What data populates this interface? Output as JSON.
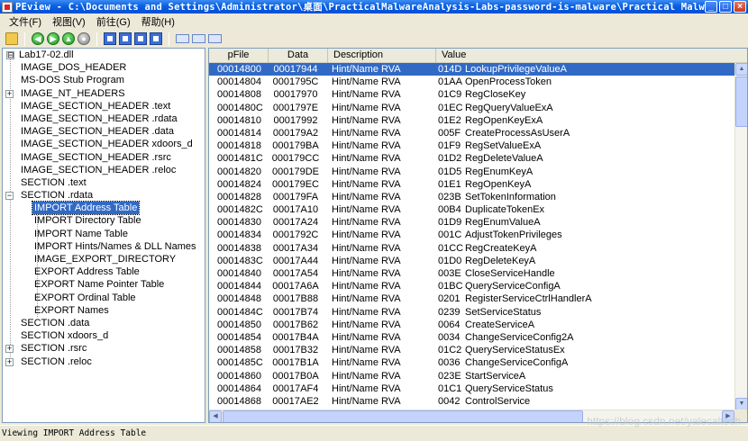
{
  "window": {
    "title": "PEview - C:\\Documents and Settings\\Administrator\\桌面\\PracticalMalwareAnalysis-Labs-password-is-malware\\Practical Malw...",
    "minimize_label": "_",
    "maximize_label": "□",
    "close_label": "×"
  },
  "menu": [
    {
      "label": "文件(F)"
    },
    {
      "label": "视图(V)"
    },
    {
      "label": "前往(G)"
    },
    {
      "label": "帮助(H)"
    }
  ],
  "toolbar": {
    "icons": [
      "open-folder-icon",
      "back-icon",
      "forward-icon",
      "up-icon",
      "refresh-icon",
      "page-prev-icon",
      "page-next-icon",
      "page-first-icon",
      "page-last-icon",
      "view-byte-icon",
      "view-word-icon",
      "view-dword-icon"
    ],
    "nav_glyphs": {
      "back": "◀",
      "forward": "▶",
      "up": "▲",
      "refresh": "●"
    }
  },
  "tree": {
    "items": [
      {
        "label": "Lab17-02.dll",
        "level": 0,
        "expander": "⊟"
      },
      {
        "label": "IMAGE_DOS_HEADER",
        "level": 1,
        "expander": ""
      },
      {
        "label": "MS-DOS Stub Program",
        "level": 1,
        "expander": ""
      },
      {
        "label": "IMAGE_NT_HEADERS",
        "level": 1,
        "expander": "+"
      },
      {
        "label": "IMAGE_SECTION_HEADER .text",
        "level": 1,
        "expander": ""
      },
      {
        "label": "IMAGE_SECTION_HEADER .rdata",
        "level": 1,
        "expander": ""
      },
      {
        "label": "IMAGE_SECTION_HEADER .data",
        "level": 1,
        "expander": ""
      },
      {
        "label": "IMAGE_SECTION_HEADER xdoors_d",
        "level": 1,
        "expander": ""
      },
      {
        "label": "IMAGE_SECTION_HEADER .rsrc",
        "level": 1,
        "expander": ""
      },
      {
        "label": "IMAGE_SECTION_HEADER .reloc",
        "level": 1,
        "expander": ""
      },
      {
        "label": "SECTION .text",
        "level": 1,
        "expander": ""
      },
      {
        "label": "SECTION .rdata",
        "level": 1,
        "expander": "−"
      },
      {
        "label": "IMPORT Address Table",
        "level": 2,
        "expander": "",
        "selected": true
      },
      {
        "label": "IMPORT Directory Table",
        "level": 2,
        "expander": ""
      },
      {
        "label": "IMPORT Name Table",
        "level": 2,
        "expander": ""
      },
      {
        "label": "IMPORT Hints/Names & DLL Names",
        "level": 2,
        "expander": ""
      },
      {
        "label": "IMAGE_EXPORT_DIRECTORY",
        "level": 2,
        "expander": ""
      },
      {
        "label": "EXPORT Address Table",
        "level": 2,
        "expander": ""
      },
      {
        "label": "EXPORT Name Pointer Table",
        "level": 2,
        "expander": ""
      },
      {
        "label": "EXPORT Ordinal Table",
        "level": 2,
        "expander": ""
      },
      {
        "label": "EXPORT Names",
        "level": 2,
        "expander": ""
      },
      {
        "label": "SECTION .data",
        "level": 1,
        "expander": ""
      },
      {
        "label": "SECTION xdoors_d",
        "level": 1,
        "expander": ""
      },
      {
        "label": "SECTION .rsrc",
        "level": 1,
        "expander": "+"
      },
      {
        "label": "SECTION .reloc",
        "level": 1,
        "expander": "+"
      }
    ]
  },
  "table": {
    "columns": [
      "pFile",
      "Data",
      "Description",
      "Value"
    ],
    "rows": [
      {
        "pfile": "00014800",
        "data": "00017944",
        "desc": "Hint/Name RVA",
        "hint": "014D",
        "name": "LookupPrivilegeValueA",
        "selected": true
      },
      {
        "pfile": "00014804",
        "data": "0001795C",
        "desc": "Hint/Name RVA",
        "hint": "01AA",
        "name": "OpenProcessToken"
      },
      {
        "pfile": "00014808",
        "data": "00017970",
        "desc": "Hint/Name RVA",
        "hint": "01C9",
        "name": "RegCloseKey"
      },
      {
        "pfile": "0001480C",
        "data": "0001797E",
        "desc": "Hint/Name RVA",
        "hint": "01EC",
        "name": "RegQueryValueExA"
      },
      {
        "pfile": "00014810",
        "data": "00017992",
        "desc": "Hint/Name RVA",
        "hint": "01E2",
        "name": "RegOpenKeyExA"
      },
      {
        "pfile": "00014814",
        "data": "000179A2",
        "desc": "Hint/Name RVA",
        "hint": "005F",
        "name": "CreateProcessAsUserA"
      },
      {
        "pfile": "00014818",
        "data": "000179BA",
        "desc": "Hint/Name RVA",
        "hint": "01F9",
        "name": "RegSetValueExA"
      },
      {
        "pfile": "0001481C",
        "data": "000179CC",
        "desc": "Hint/Name RVA",
        "hint": "01D2",
        "name": "RegDeleteValueA"
      },
      {
        "pfile": "00014820",
        "data": "000179DE",
        "desc": "Hint/Name RVA",
        "hint": "01D5",
        "name": "RegEnumKeyA"
      },
      {
        "pfile": "00014824",
        "data": "000179EC",
        "desc": "Hint/Name RVA",
        "hint": "01E1",
        "name": "RegOpenKeyA"
      },
      {
        "pfile": "00014828",
        "data": "000179FA",
        "desc": "Hint/Name RVA",
        "hint": "023B",
        "name": "SetTokenInformation"
      },
      {
        "pfile": "0001482C",
        "data": "00017A10",
        "desc": "Hint/Name RVA",
        "hint": "00B4",
        "name": "DuplicateTokenEx"
      },
      {
        "pfile": "00014830",
        "data": "00017A24",
        "desc": "Hint/Name RVA",
        "hint": "01D9",
        "name": "RegEnumValueA"
      },
      {
        "pfile": "00014834",
        "data": "0001792C",
        "desc": "Hint/Name RVA",
        "hint": "001C",
        "name": "AdjustTokenPrivileges"
      },
      {
        "pfile": "00014838",
        "data": "00017A34",
        "desc": "Hint/Name RVA",
        "hint": "01CC",
        "name": "RegCreateKeyA"
      },
      {
        "pfile": "0001483C",
        "data": "00017A44",
        "desc": "Hint/Name RVA",
        "hint": "01D0",
        "name": "RegDeleteKeyA"
      },
      {
        "pfile": "00014840",
        "data": "00017A54",
        "desc": "Hint/Name RVA",
        "hint": "003E",
        "name": "CloseServiceHandle"
      },
      {
        "pfile": "00014844",
        "data": "00017A6A",
        "desc": "Hint/Name RVA",
        "hint": "01BC",
        "name": "QueryServiceConfigA"
      },
      {
        "pfile": "00014848",
        "data": "00017B88",
        "desc": "Hint/Name RVA",
        "hint": "0201",
        "name": "RegisterServiceCtrlHandlerA"
      },
      {
        "pfile": "0001484C",
        "data": "00017B74",
        "desc": "Hint/Name RVA",
        "hint": "0239",
        "name": "SetServiceStatus"
      },
      {
        "pfile": "00014850",
        "data": "00017B62",
        "desc": "Hint/Name RVA",
        "hint": "0064",
        "name": "CreateServiceA"
      },
      {
        "pfile": "00014854",
        "data": "00017B4A",
        "desc": "Hint/Name RVA",
        "hint": "0034",
        "name": "ChangeServiceConfig2A"
      },
      {
        "pfile": "00014858",
        "data": "00017B32",
        "desc": "Hint/Name RVA",
        "hint": "01C2",
        "name": "QueryServiceStatusEx"
      },
      {
        "pfile": "0001485C",
        "data": "00017B1A",
        "desc": "Hint/Name RVA",
        "hint": "0036",
        "name": "ChangeServiceConfigA"
      },
      {
        "pfile": "00014860",
        "data": "00017B0A",
        "desc": "Hint/Name RVA",
        "hint": "023E",
        "name": "StartServiceA"
      },
      {
        "pfile": "00014864",
        "data": "00017AF4",
        "desc": "Hint/Name RVA",
        "hint": "01C1",
        "name": "QueryServiceStatus"
      },
      {
        "pfile": "00014868",
        "data": "00017AE2",
        "desc": "Hint/Name RVA",
        "hint": "0042",
        "name": "ControlService"
      }
    ]
  },
  "status": {
    "text": "Viewing IMPORT Address Table"
  },
  "watermark": "https://blog.csdn.net/yalecaltech",
  "colors": {
    "selection": "#316ac5",
    "titlebar": "#0a5fe0"
  }
}
